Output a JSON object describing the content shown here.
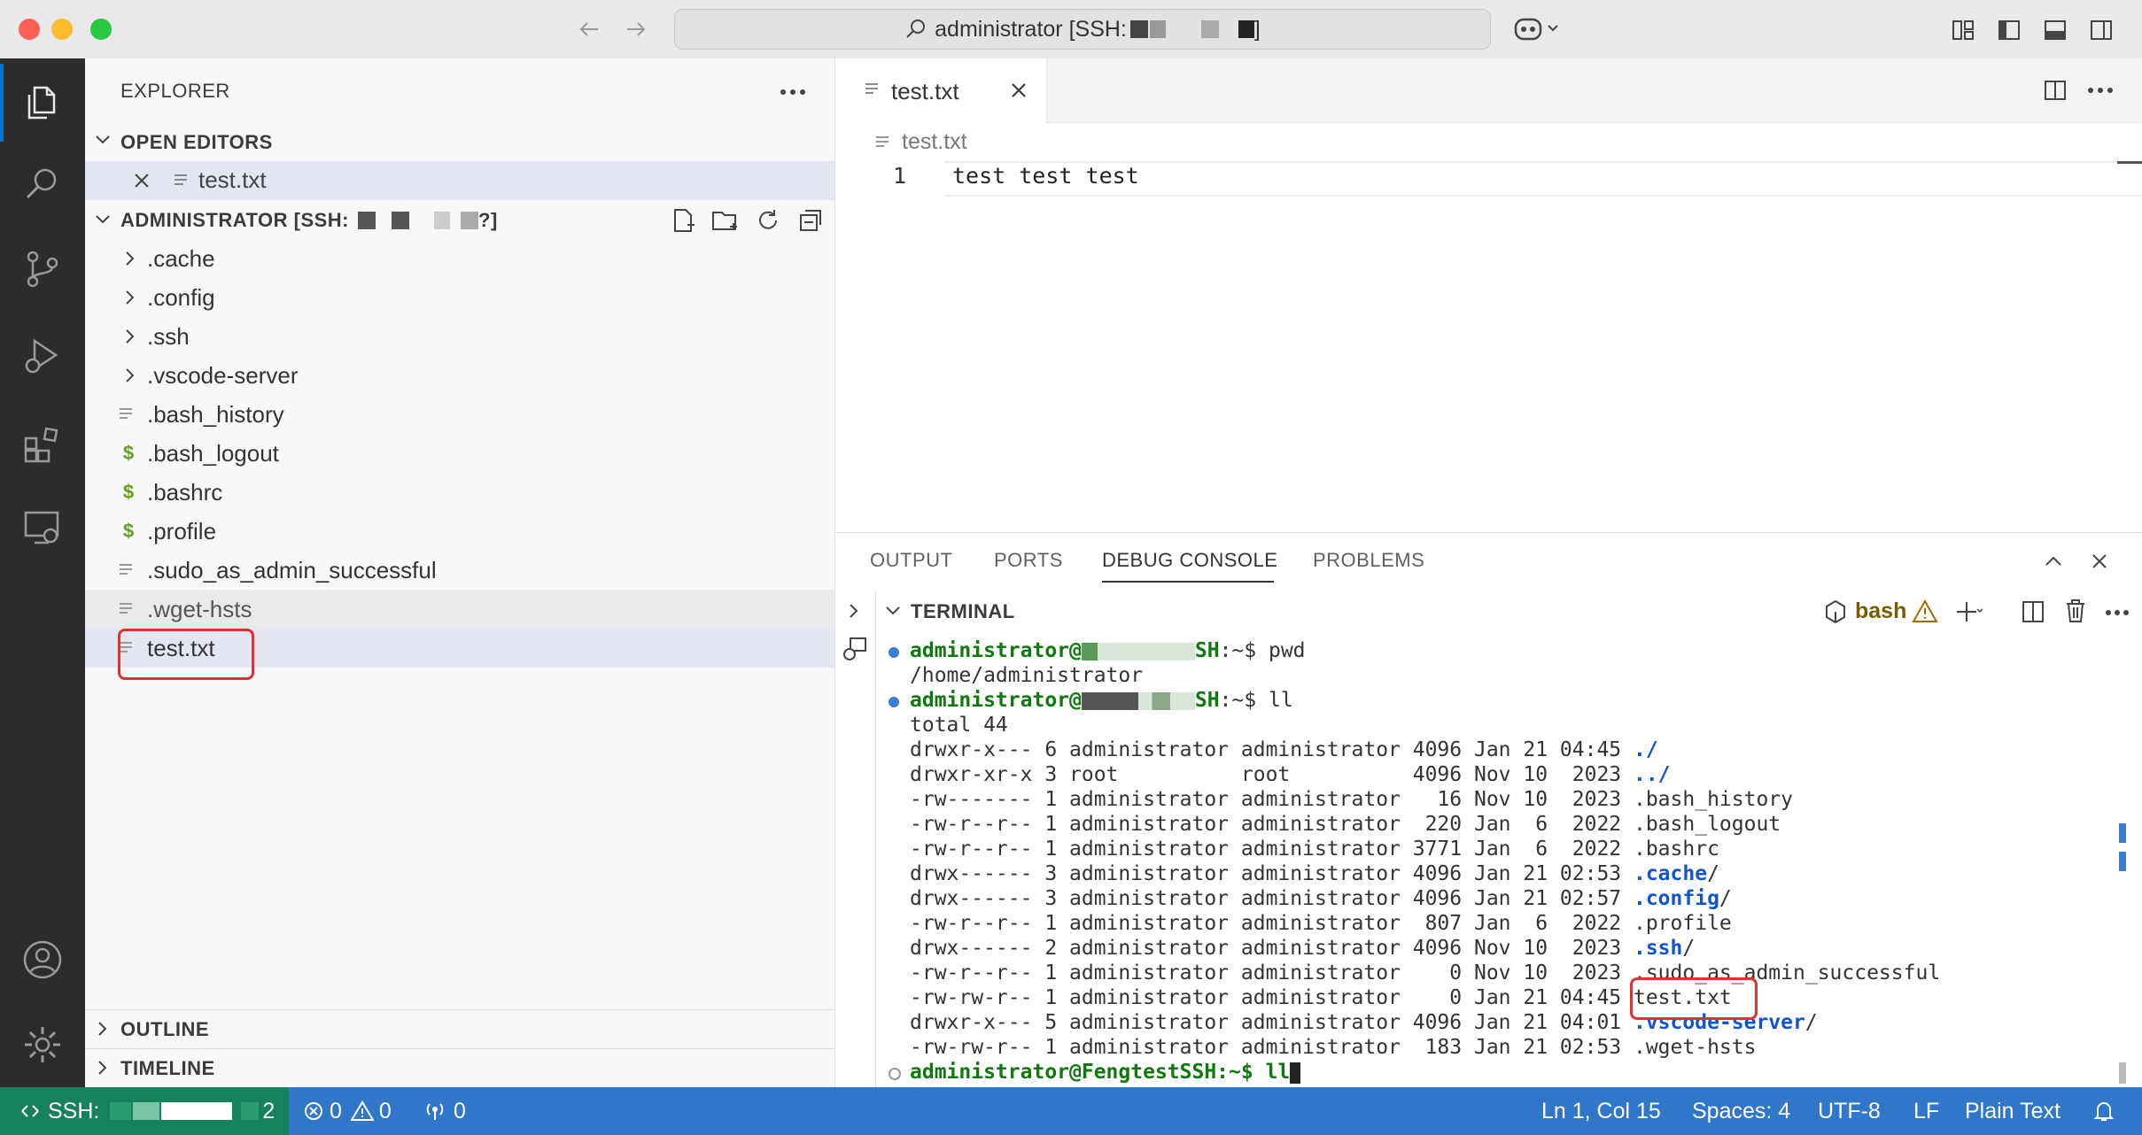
{
  "window": {
    "search_text": "administrator [SSH:",
    "search_suffix": "]"
  },
  "sidebar": {
    "title": "EXPLORER",
    "open_editors_label": "OPEN EDITORS",
    "open_editors": [
      {
        "name": "test.txt"
      }
    ],
    "workspace_label": "ADMINISTRATOR [SSH:",
    "workspace_suffix": "?]",
    "tree": [
      {
        "name": ".cache",
        "kind": "folder"
      },
      {
        "name": ".config",
        "kind": "folder"
      },
      {
        "name": ".ssh",
        "kind": "folder"
      },
      {
        "name": ".vscode-server",
        "kind": "folder"
      },
      {
        "name": ".bash_history",
        "kind": "text"
      },
      {
        "name": ".bash_logout",
        "kind": "shell"
      },
      {
        "name": ".bashrc",
        "kind": "shell"
      },
      {
        "name": ".profile",
        "kind": "shell"
      },
      {
        "name": ".sudo_as_admin_successful",
        "kind": "text"
      },
      {
        "name": ".wget-hsts",
        "kind": "text"
      },
      {
        "name": "test.txt",
        "kind": "text"
      }
    ],
    "outline_label": "OUTLINE",
    "timeline_label": "TIMELINE"
  },
  "editor": {
    "tab_label": "test.txt",
    "breadcrumb": "test.txt",
    "line_number": "1",
    "line_text": "test test test"
  },
  "panel": {
    "tabs": [
      "OUTPUT",
      "PORTS",
      "DEBUG CONSOLE",
      "PROBLEMS"
    ],
    "active_tab": "DEBUG CONSOLE",
    "terminal_label": "TERMINAL",
    "shell_label": "bash",
    "prompt_user": "administrator@",
    "prompt_host_tail": "SH",
    "prompt_suffix_pwd": ":~$ pwd",
    "prompt_suffix_ll": ":~$ ll",
    "pwd_output": "/home/administrator",
    "total_line": "total 44",
    "listing": [
      {
        "meta": "drwxr-x--- 6 administrator administrator 4096 Jan 21 04:45 ",
        "name": "./",
        "dir": true
      },
      {
        "meta": "drwxr-xr-x 3 root          root          4096 Nov 10  2023 ",
        "name": "../",
        "dir": true
      },
      {
        "meta": "-rw------- 1 administrator administrator   16 Nov 10  2023 ",
        "name": ".bash_history",
        "dir": false
      },
      {
        "meta": "-rw-r--r-- 1 administrator administrator  220 Jan  6  2022 ",
        "name": ".bash_logout",
        "dir": false
      },
      {
        "meta": "-rw-r--r-- 1 administrator administrator 3771 Jan  6  2022 ",
        "name": ".bashrc",
        "dir": false
      },
      {
        "meta": "drwx------ 3 administrator administrator 4096 Jan 21 02:53 ",
        "name": ".cache",
        "dir": true
      },
      {
        "meta": "drwx------ 3 administrator administrator 4096 Jan 21 02:57 ",
        "name": ".config",
        "dir": true
      },
      {
        "meta": "-rw-r--r-- 1 administrator administrator  807 Jan  6  2022 ",
        "name": ".profile",
        "dir": false
      },
      {
        "meta": "drwx------ 2 administrator administrator 4096 Nov 10  2023 ",
        "name": ".ssh",
        "dir": true
      },
      {
        "meta": "-rw-r--r-- 1 administrator administrator    0 Nov 10  2023 ",
        "name": ".sudo_as_admin_successful",
        "dir": false
      },
      {
        "meta": "-rw-rw-r-- 1 administrator administrator    0 Jan 21 04:45 ",
        "name": "test.txt",
        "dir": false
      },
      {
        "meta": "drwxr-x--- 5 administrator administrator 4096 Jan 21 04:01 ",
        "name": ".vscode-server",
        "dir": true
      },
      {
        "meta": "-rw-rw-r-- 1 administrator administrator  183 Jan 21 02:53 ",
        "name": ".wget-hsts",
        "dir": false
      }
    ],
    "last_prompt": "administrator@FengtestSSH:~$ ll"
  },
  "statusbar": {
    "remote": "SSH:",
    "remote_tail": "2",
    "errors": "0",
    "warnings": "0",
    "ports": "0",
    "position": "Ln 1, Col 15",
    "spaces": "Spaces: 4",
    "encoding": "UTF-8",
    "eol": "LF",
    "language": "Plain Text"
  },
  "colors": {
    "accent": "#3076c9",
    "remote": "#16825d",
    "prompt_green": "#0e7a0e",
    "dir_blue": "#1155cc",
    "highlight": "#e03030"
  }
}
